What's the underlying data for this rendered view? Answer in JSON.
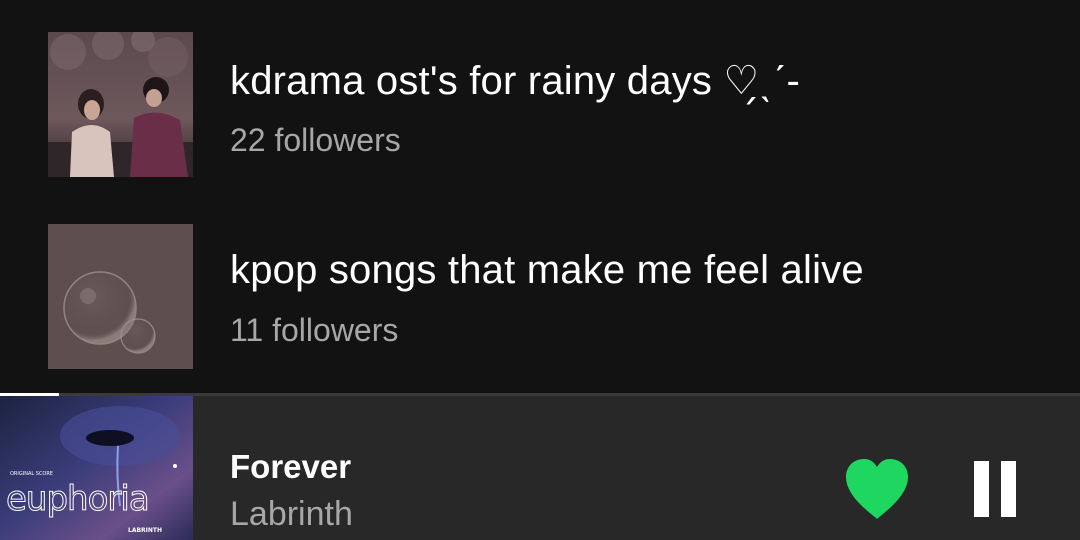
{
  "playlists": [
    {
      "title": "kdrama ost's for rainy days ♡̗ˎˊ-",
      "followers": "22 followers",
      "cover_icon": "couple-photo-cover"
    },
    {
      "title": "kpop songs that make me feel alive",
      "followers": "11 followers",
      "cover_icon": "bubbles-cover"
    }
  ],
  "now_playing": {
    "title": "Forever",
    "artist": "Labrinth",
    "album_art_text": "euphoria",
    "album_art_small_text": "ORIGINAL SCORE",
    "album_art_credit": "LABRINTH",
    "progress": 0.055,
    "liked": true,
    "like_icon": "heart-icon",
    "pause_icon": "pause-icon"
  },
  "colors": {
    "background": "#121212",
    "mini_player": "#282828",
    "accent_green": "#1ed760",
    "subtext": "#a7a7a7"
  }
}
